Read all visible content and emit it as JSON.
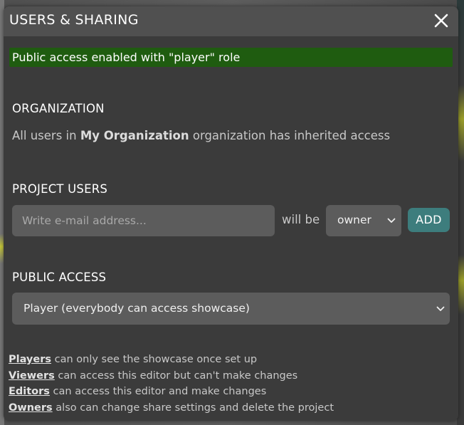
{
  "dialog": {
    "title": "USERS & SHARING",
    "close_icon": "close-x-icon"
  },
  "banner": {
    "text": "Public access enabled with \"player\" role",
    "color": "#1f5c10"
  },
  "organization": {
    "heading": "ORGANIZATION",
    "text_prefix": "All users in",
    "org_name": "My Organization",
    "text_suffix": "organization has inherited access"
  },
  "project_users": {
    "heading": "PROJECT USERS",
    "email_placeholder": "Write e-mail address...",
    "email_value": "",
    "will_be_label": "will be",
    "role_value": "owner",
    "add_label": "ADD",
    "add_color": "#3d7d7d"
  },
  "public_access": {
    "heading": "PUBLIC ACCESS",
    "selected": "Player (everybody can access showcase)"
  },
  "legend": [
    {
      "term": "Players",
      "description": "can only see the showcase once set up"
    },
    {
      "term": "Viewers",
      "description": "can access this editor but can't make changes"
    },
    {
      "term": "Editors",
      "description": "can access this editor and make changes"
    },
    {
      "term": "Owners",
      "description": "also can change share settings and delete the project"
    }
  ]
}
